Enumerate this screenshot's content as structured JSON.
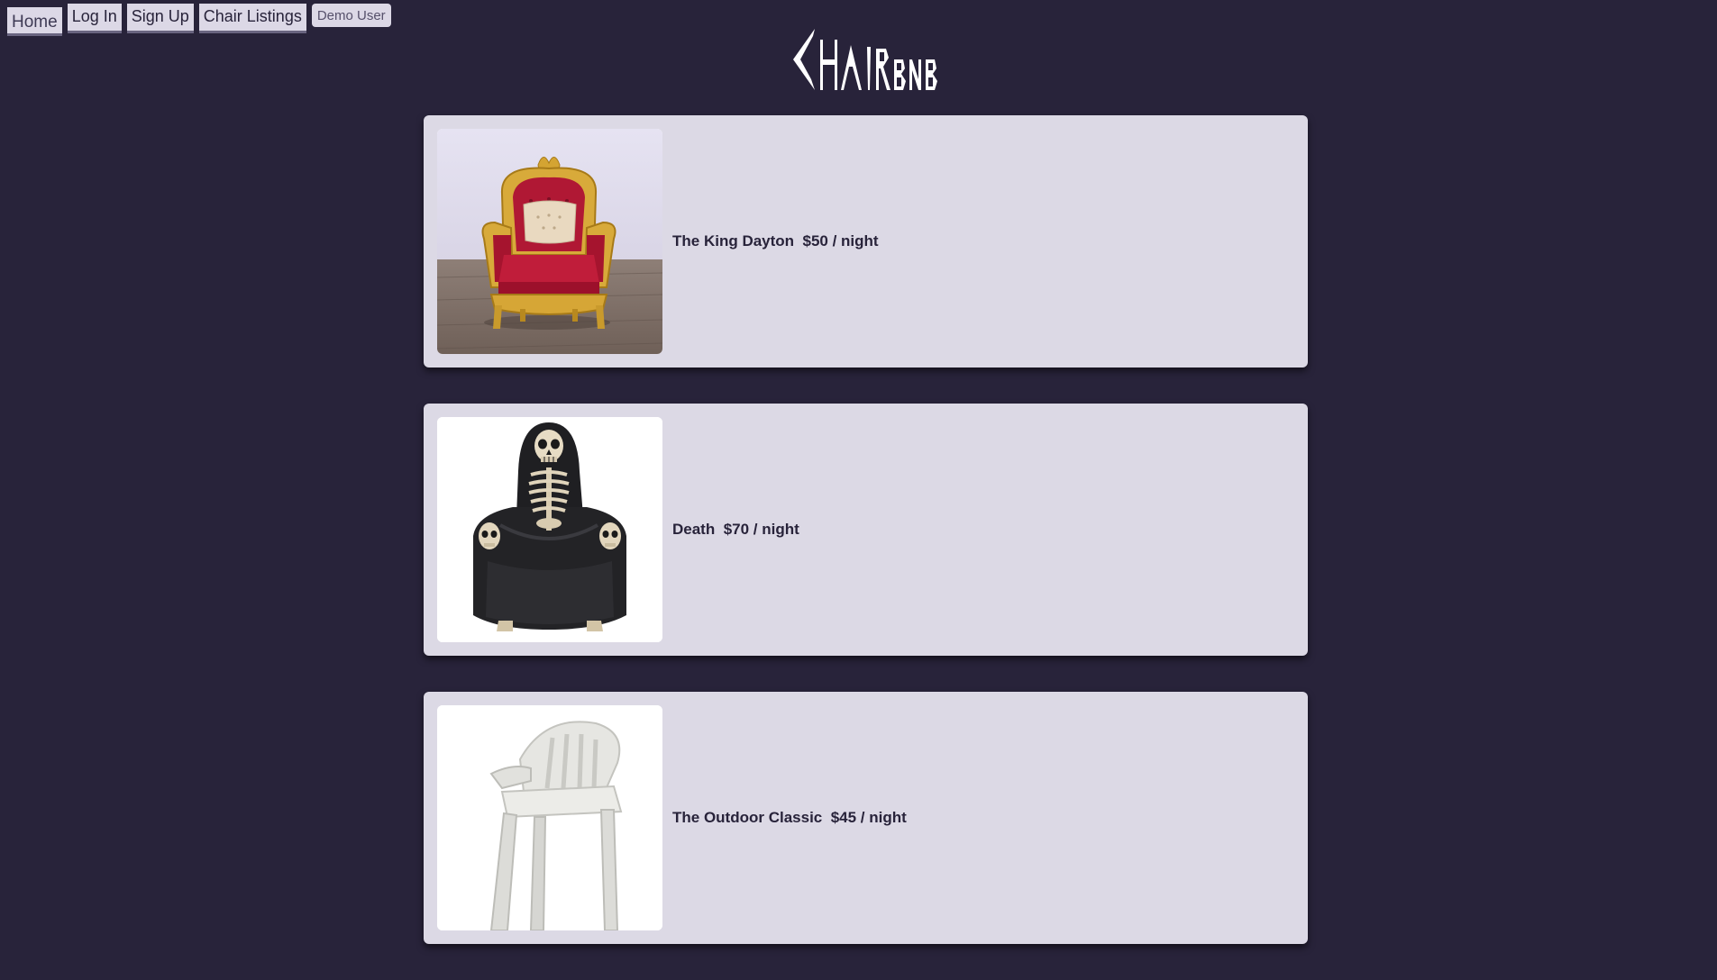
{
  "nav": {
    "home": "Home",
    "login": "Log In",
    "signup": "Sign Up",
    "listings": "Chair Listings",
    "demo": "Demo User"
  },
  "logo": {
    "text": "ChairBnB"
  },
  "listings": [
    {
      "name": "The King Dayton",
      "price": "$50 / night"
    },
    {
      "name": "Death",
      "price": "$70 / night"
    },
    {
      "name": "The Outdoor Classic",
      "price": "$45 / night"
    }
  ],
  "colors": {
    "background": "#28233a",
    "card": "#dcd9e5"
  }
}
